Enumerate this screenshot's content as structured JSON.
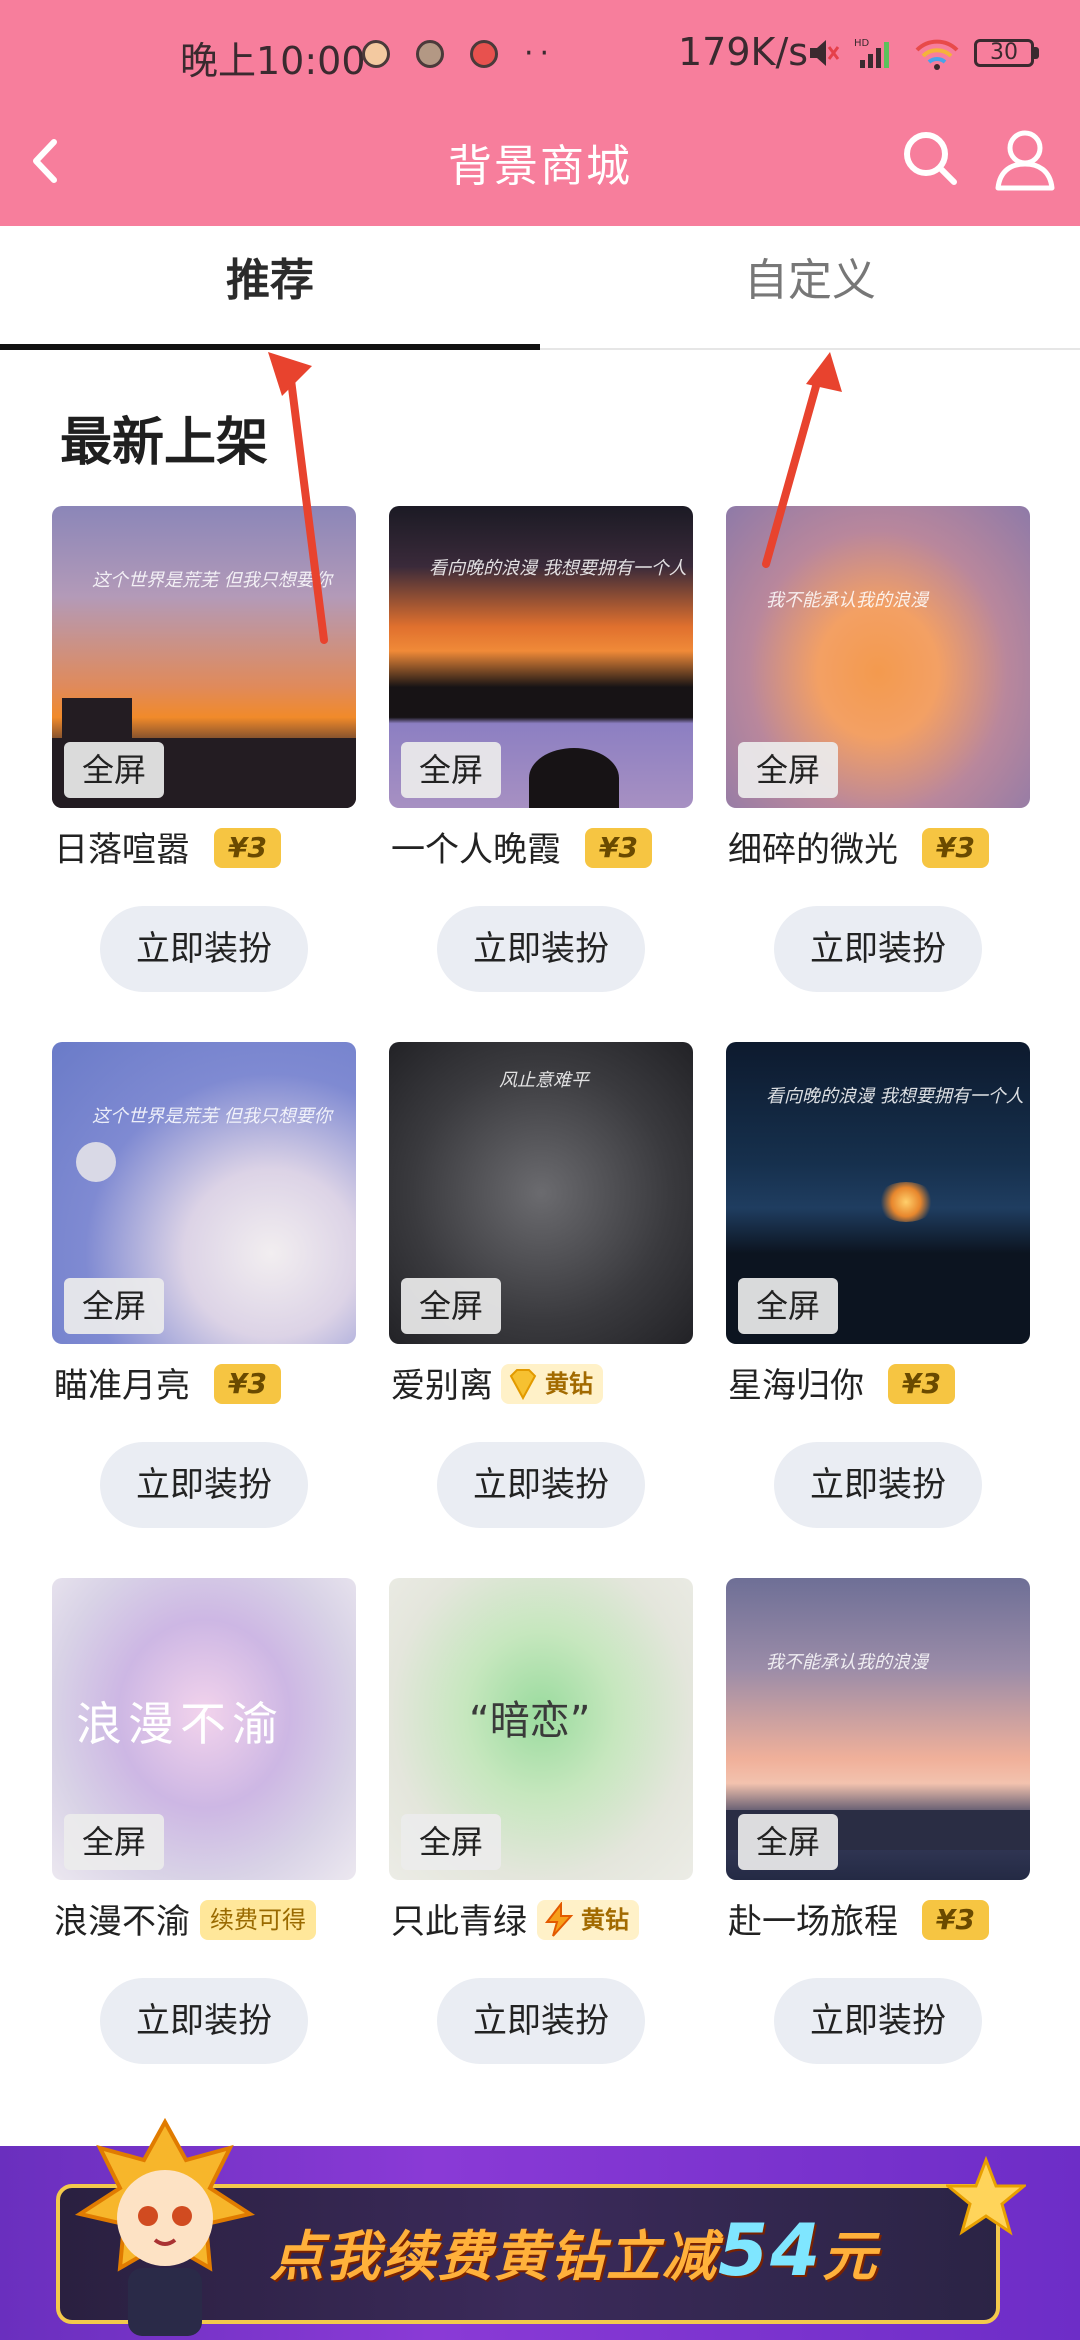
{
  "status": {
    "time": "晚上10:00",
    "speed": "179K/s",
    "battery": "30"
  },
  "header": {
    "title": "背景商城"
  },
  "tabs": [
    {
      "label": "推荐"
    },
    {
      "label": "自定义"
    }
  ],
  "section": {
    "title": "最新上架"
  },
  "common": {
    "fullscreen_label": "全屏",
    "apply_label": "立即装扮"
  },
  "items": [
    {
      "name": "日落喧嚣",
      "badge": "¥3",
      "badge_type": "price",
      "thumb_text": "这个世界是荒芜 但我只想要你"
    },
    {
      "name": "一个人晚霞",
      "badge": "¥3",
      "badge_type": "price",
      "thumb_text": "看向晚的浪漫 我想要拥有一个人"
    },
    {
      "name": "细碎的微光",
      "badge": "¥3",
      "badge_type": "price",
      "thumb_text": "我不能承认我的浪漫"
    },
    {
      "name": "瞄准月亮",
      "badge": "¥3",
      "badge_type": "price",
      "thumb_text": "这个世界是荒芜 但我只想要你"
    },
    {
      "name": "爱别离",
      "badge": "黄钻",
      "badge_type": "vip",
      "thumb_text": "风止意难平"
    },
    {
      "name": "星海归你",
      "badge": "¥3",
      "badge_type": "price",
      "thumb_text": "看向晚的浪漫 我想要拥有一个人"
    },
    {
      "name": "浪漫不渝",
      "badge": "续费可得",
      "badge_type": "renew",
      "thumb_text": "浪漫不渝"
    },
    {
      "name": "只此青绿",
      "badge": "黄钻",
      "badge_type": "vip",
      "thumb_text": "“暗恋”"
    },
    {
      "name": "赴一场旅程",
      "badge": "¥3",
      "badge_type": "price",
      "thumb_text": "我不能承认我的浪漫"
    }
  ],
  "banner": {
    "text_prefix": "点我续费黄钻立减",
    "amount": "54",
    "suffix": "元"
  },
  "colors": {
    "header": "#f77e9c",
    "price_badge": "#f6c542",
    "button_bg": "#eaedf3",
    "arrow": "#e8432e"
  }
}
